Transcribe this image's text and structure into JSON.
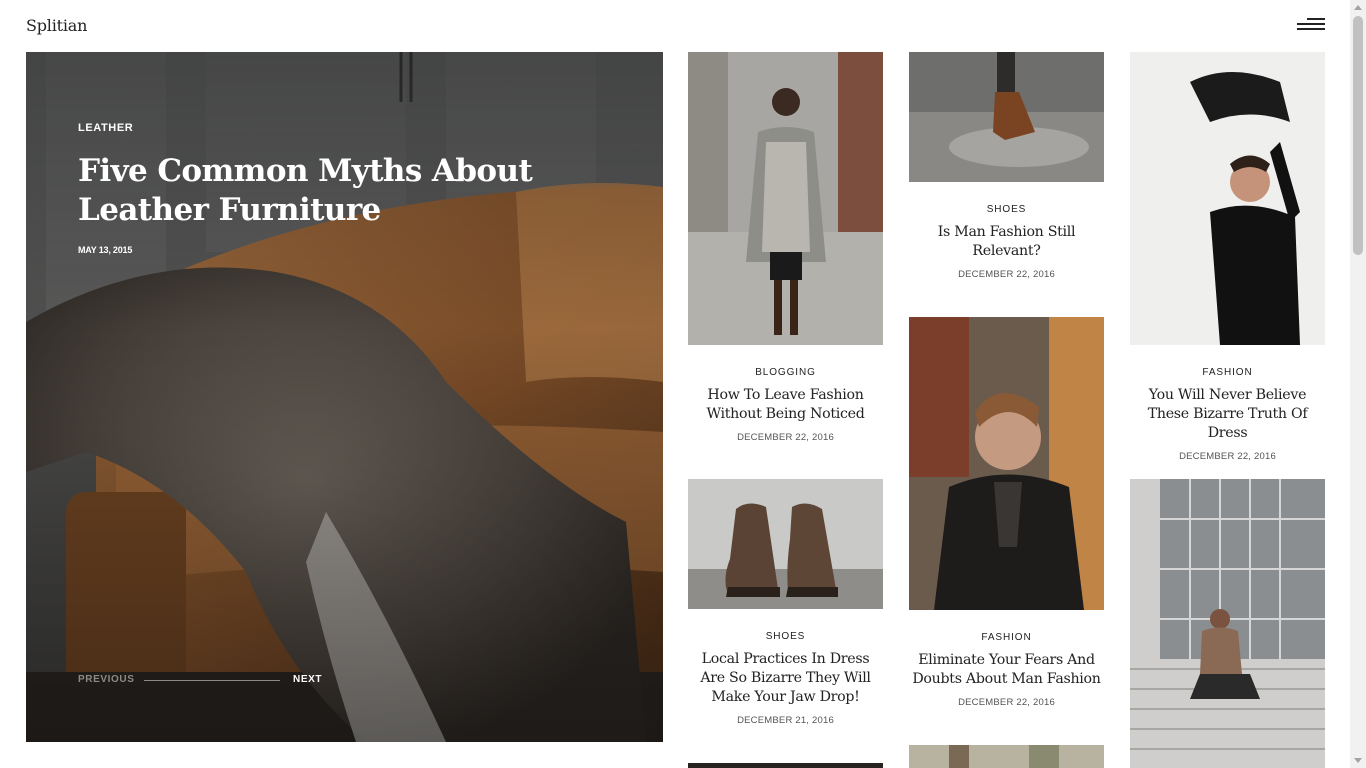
{
  "header": {
    "logo": "Splitian",
    "menu_icon": "hamburger-menu-icon"
  },
  "hero": {
    "category": "LEATHER",
    "title": "Five Common Myths About Leather Furniture",
    "date": "MAY 13, 2015",
    "prev_label": "PREVIOUS",
    "next_label": "NEXT"
  },
  "posts": [
    {
      "category": "BLOGGING",
      "title": "How To Leave Fashion Without Being Noticed",
      "date": "DECEMBER 22, 2016"
    },
    {
      "category": "SHOES",
      "title": "Is Man Fashion Still Relevant?",
      "date": "DECEMBER 22, 2016"
    },
    {
      "category": "FASHION",
      "title": "You Will Never Believe These Bizarre Truth Of Dress",
      "date": "DECEMBER 22, 2016"
    },
    {
      "category": "SHOES",
      "title": "Local Practices In Dress Are So Bizarre They Will Make Your Jaw Drop!",
      "date": "DECEMBER 21, 2016"
    },
    {
      "category": "FASHION",
      "title": "Eliminate Your Fears And Doubts About Man Fashion",
      "date": "DECEMBER 22, 2016"
    }
  ],
  "colors": {
    "text": "#222222",
    "muted": "#8d8a86",
    "leather": "#8a5a32"
  }
}
